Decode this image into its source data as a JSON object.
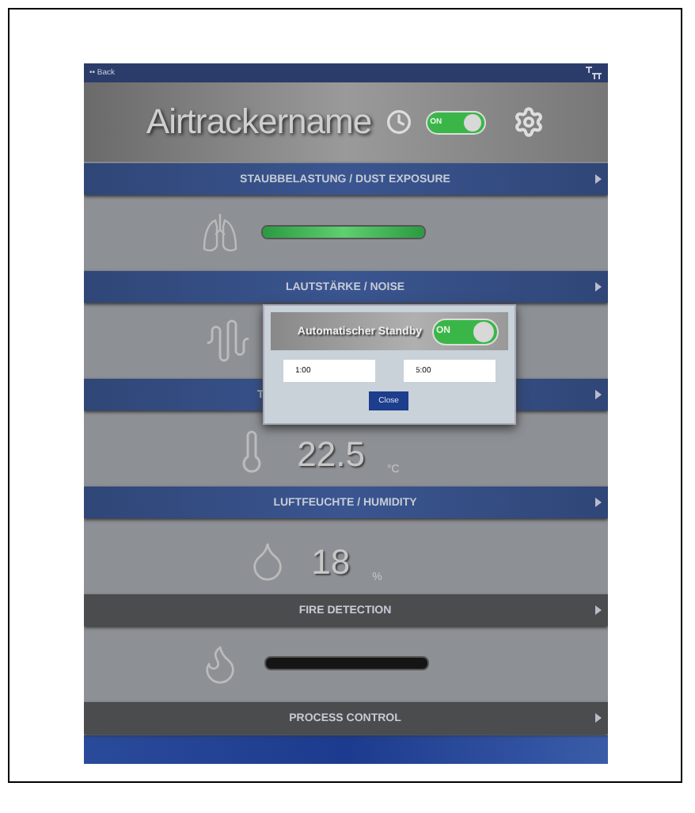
{
  "top_bar": {
    "back": "•• Back"
  },
  "header": {
    "title": "Airtrackername",
    "power": {
      "label": "ON",
      "on": true
    }
  },
  "sections": [
    {
      "title": "STAUBBELASTUNG / DUST EXPOSURE",
      "enabled": true,
      "partially_hidden": false,
      "reading": {
        "kind": "meter",
        "level": 1
      }
    },
    {
      "title": "LAUTSTÄRKE / NOISE",
      "enabled": true,
      "partially_hidden": false,
      "reading": {
        "kind": "icon"
      }
    },
    {
      "title": "T",
      "enabled": true,
      "partially_hidden": true,
      "reading": {
        "kind": "value",
        "value": "22.5",
        "unit": "°C"
      }
    },
    {
      "title": "LUFTFEUCHTE / HUMIDITY",
      "enabled": true,
      "partially_hidden": false,
      "reading": {
        "kind": "value",
        "value": "18",
        "unit": "%"
      }
    },
    {
      "title": "FIRE DETECTION",
      "enabled": false,
      "partially_hidden": false,
      "reading": {
        "kind": "meter",
        "level": 0
      }
    },
    {
      "title": "PROCESS CONTROL",
      "enabled": false,
      "partially_hidden": false
    }
  ],
  "dialog": {
    "title": "Automatischer Standby",
    "toggle": {
      "label": "ON",
      "on": true
    },
    "from": "1:00",
    "to": "5:00",
    "button": "Close"
  }
}
